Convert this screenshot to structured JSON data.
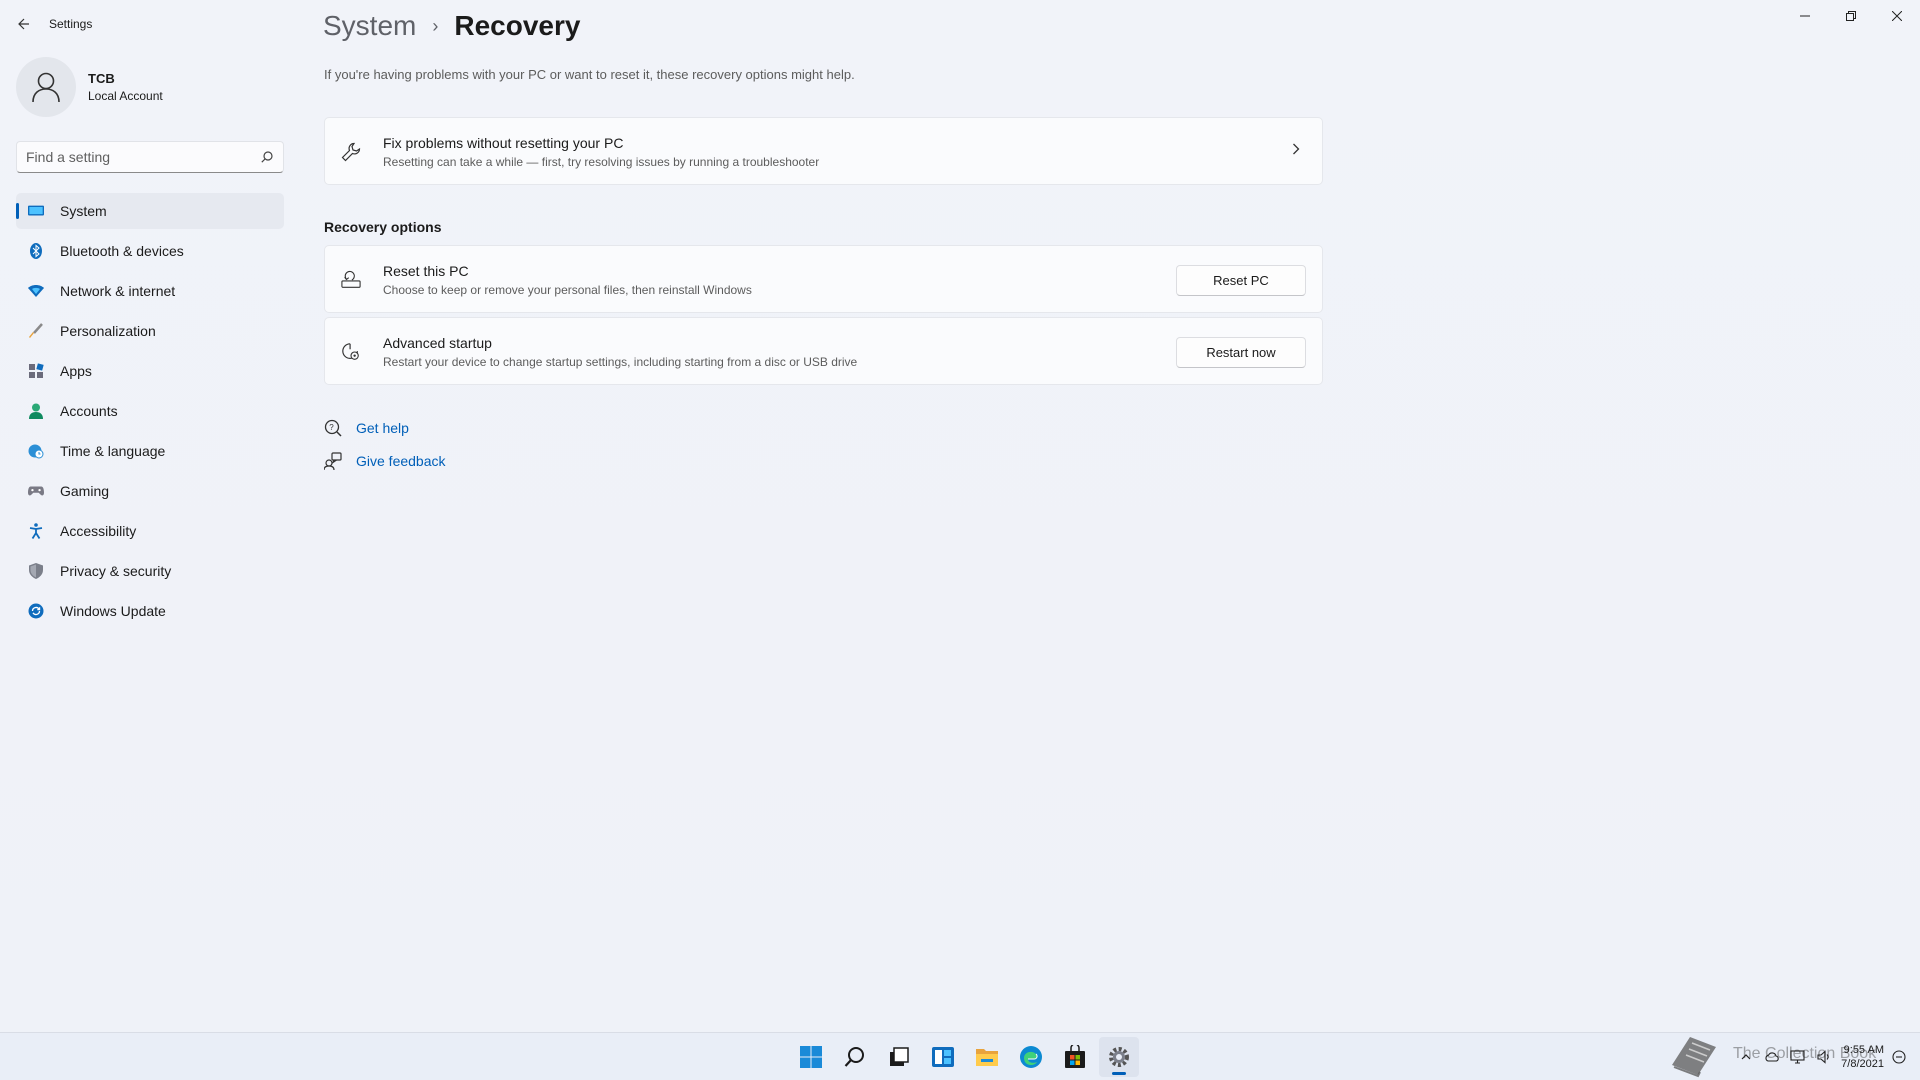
{
  "window": {
    "app_title": "Settings",
    "controls": [
      "minimize",
      "restore",
      "close"
    ]
  },
  "profile": {
    "name": "TCB",
    "account_type": "Local Account"
  },
  "search": {
    "placeholder": "Find a setting"
  },
  "sidebar": {
    "items": [
      {
        "label": "System",
        "icon": "system-icon",
        "active": true
      },
      {
        "label": "Bluetooth & devices",
        "icon": "bluetooth-icon"
      },
      {
        "label": "Network & internet",
        "icon": "wifi-icon"
      },
      {
        "label": "Personalization",
        "icon": "brush-icon"
      },
      {
        "label": "Apps",
        "icon": "apps-icon"
      },
      {
        "label": "Accounts",
        "icon": "person-icon"
      },
      {
        "label": "Time & language",
        "icon": "globe-clock-icon"
      },
      {
        "label": "Gaming",
        "icon": "gamepad-icon"
      },
      {
        "label": "Accessibility",
        "icon": "accessibility-icon"
      },
      {
        "label": "Privacy & security",
        "icon": "shield-icon"
      },
      {
        "label": "Windows Update",
        "icon": "update-icon"
      }
    ]
  },
  "breadcrumb": {
    "parent": "System",
    "separator": "›",
    "current": "Recovery"
  },
  "intro_text": "If you're having problems with your PC or want to reset it, these recovery options might help.",
  "fix_card": {
    "title": "Fix problems without resetting your PC",
    "description": "Resetting can take a while — first, try resolving issues by running a troubleshooter"
  },
  "recovery_options": {
    "section_title": "Recovery options",
    "reset": {
      "title": "Reset this PC",
      "description": "Choose to keep or remove your personal files, then reinstall Windows",
      "button": "Reset PC"
    },
    "advanced": {
      "title": "Advanced startup",
      "description": "Restart your device to change startup settings, including starting from a disc or USB drive",
      "button": "Restart now"
    }
  },
  "help": {
    "get_help": "Get help",
    "give_feedback": "Give feedback"
  },
  "taskbar": {
    "apps": [
      "start-icon",
      "search-icon",
      "task-view-icon",
      "widgets-icon",
      "file-explorer-icon",
      "edge-icon",
      "store-icon",
      "settings-icon"
    ],
    "time": "9:55 AM",
    "date": "7/8/2021"
  },
  "watermark": {
    "text": "The Collection Book"
  },
  "colors": {
    "accent": "#005fb8",
    "background": "#eef1f8"
  }
}
